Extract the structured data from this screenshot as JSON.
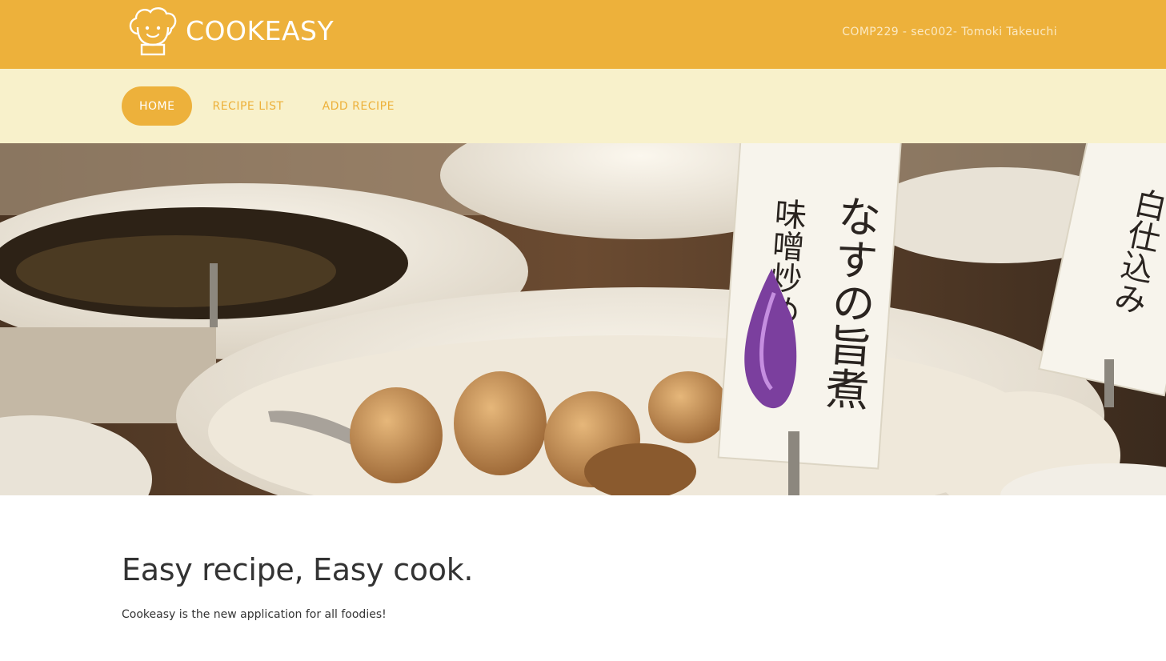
{
  "header": {
    "brand_name": "COOKEASY",
    "logo_icon": "chef-hat-face-icon",
    "byline": "COMP229 - sec002- Tomoki Takeuchi",
    "background_color": "#edb13b"
  },
  "nav": {
    "background_color": "#f8f1cb",
    "items": [
      {
        "label": "HOME",
        "active": true
      },
      {
        "label": "RECIPE LIST",
        "active": false
      },
      {
        "label": "ADD RECIPE",
        "active": false
      }
    ]
  },
  "hero": {
    "image": "japanese-food-display-photo",
    "sign_1_text": "なすの旨煮",
    "sign_1_sub": "味噌炒め",
    "sign_2_text": "白仕込み"
  },
  "main": {
    "headline": "Easy recipe, Easy cook.",
    "tagline": "Cookeasy is the new application for all foodies!"
  }
}
